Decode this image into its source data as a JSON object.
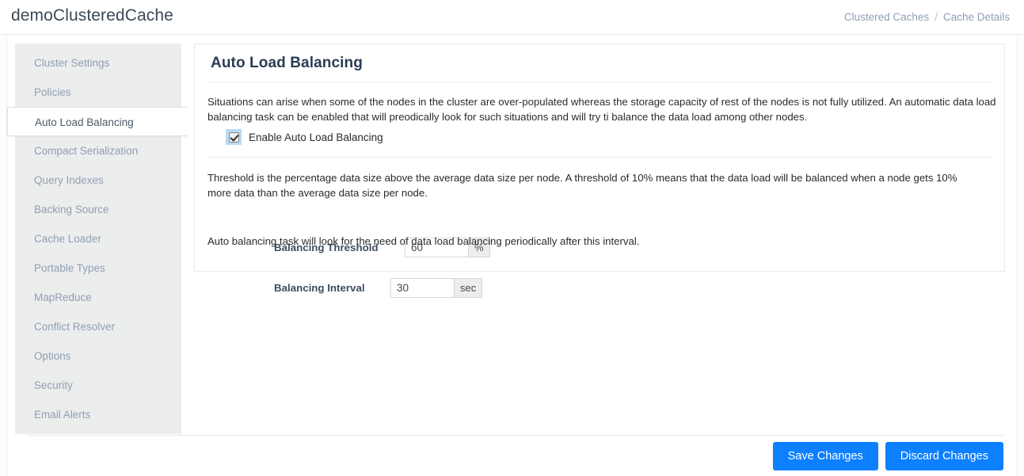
{
  "header": {
    "brand": "demoClusteredCache",
    "breadcrumb": {
      "parent": "Clustered Caches",
      "separator": "/",
      "current": "Cache Details"
    }
  },
  "sidebar": {
    "items": [
      {
        "label": "Cluster Settings",
        "active": false
      },
      {
        "label": "Policies",
        "active": false
      },
      {
        "label": "Auto Load Balancing",
        "active": true
      },
      {
        "label": "Compact Serialization",
        "active": false
      },
      {
        "label": "Query Indexes",
        "active": false
      },
      {
        "label": "Backing Source",
        "active": false
      },
      {
        "label": "Cache Loader",
        "active": false
      },
      {
        "label": "Portable Types",
        "active": false
      },
      {
        "label": "MapReduce",
        "active": false
      },
      {
        "label": "Conflict Resolver",
        "active": false
      },
      {
        "label": "Options",
        "active": false
      },
      {
        "label": "Security",
        "active": false
      },
      {
        "label": "Email Alerts",
        "active": false
      }
    ]
  },
  "main": {
    "title": "Auto Load Balancing",
    "intro_paragraph": "Situations can arise when some of the nodes in the cluster are over-populated whereas the storage capacity of rest of the nodes is not fully utilized. An automatic data load balancing task can be enabled that will preodically look for such situations and will try ti balance the data load among other nodes.",
    "enable_checkbox": {
      "label": "Enable Auto Load Balancing",
      "checked": true
    },
    "threshold_paragraph": "Threshold is the percentage data size above the average data size per node. A threshold of 10% means that the data load will be balanced when a node gets 10% more data than the average data size per node.",
    "threshold_field": {
      "label": "Balancing Threshold",
      "value": "60",
      "unit": "%"
    },
    "interval_paragraph": "Auto balancing task will look for the need of data load balancing periodically after this interval.",
    "interval_field": {
      "label": "Balancing Interval",
      "value": "30",
      "unit": "sec"
    }
  },
  "footer": {
    "save_label": "Save Changes",
    "discard_label": "Discard Changes"
  },
  "colors": {
    "accent_blue": "#0d80ff",
    "title_navy": "#2b3c55",
    "sidebar_bg": "#eceded",
    "muted_text": "#8fa0b4"
  }
}
